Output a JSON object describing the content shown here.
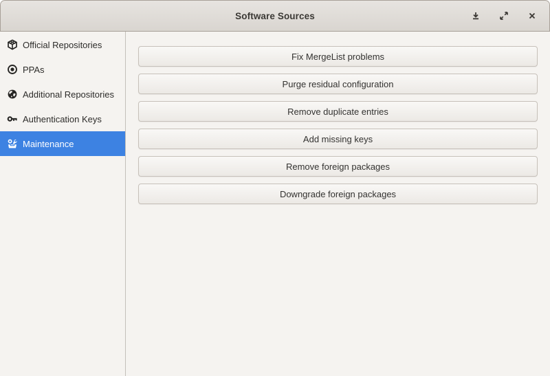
{
  "window": {
    "title": "Software Sources",
    "controls": {
      "minimize": "minimize",
      "maximize": "maximize",
      "close": "close"
    }
  },
  "sidebar": {
    "items": [
      {
        "label": "Official Repositories",
        "icon": "package-icon",
        "selected": false
      },
      {
        "label": "PPAs",
        "icon": "target-icon",
        "selected": false
      },
      {
        "label": "Additional Repositories",
        "icon": "globe-icon",
        "selected": false
      },
      {
        "label": "Authentication Keys",
        "icon": "key-icon",
        "selected": false
      },
      {
        "label": "Maintenance",
        "icon": "toolbox-icon",
        "selected": true
      }
    ]
  },
  "main": {
    "buttons": [
      "Fix MergeList problems",
      "Purge residual configuration",
      "Remove duplicate entries",
      "Add missing keys",
      "Remove foreign packages",
      "Downgrade foreign packages"
    ]
  },
  "colors": {
    "accent_selected": "#3d82e2",
    "titlebar_top": "#e7e4e0",
    "titlebar_bottom": "#d9d5d0",
    "window_background": "#f5f3f0",
    "button_border": "#c6c0b9",
    "text_dark": "#2d2c2a",
    "selected_text": "#ffffff"
  }
}
